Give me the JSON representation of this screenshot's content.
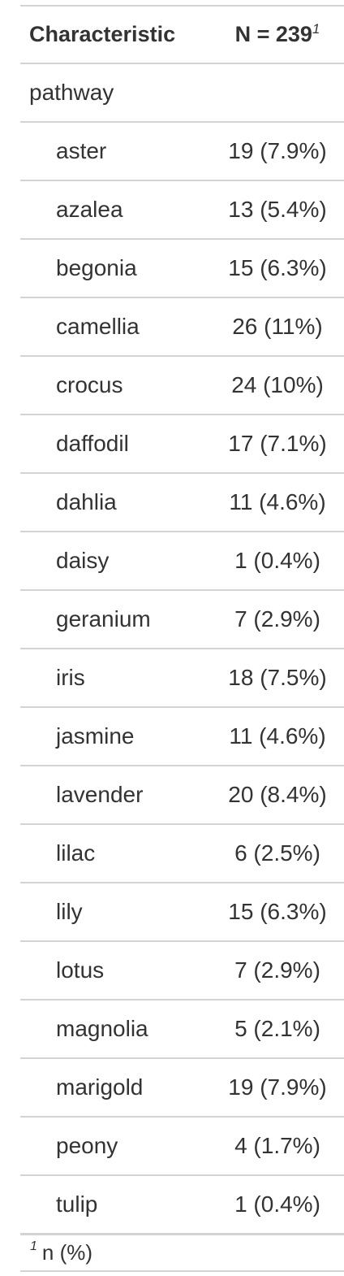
{
  "table": {
    "header": {
      "characteristic": "Characteristic",
      "n_label": "N = 239",
      "n_footnote_mark": "1"
    },
    "variable": "pathway",
    "rows": [
      {
        "label": "aster",
        "value": "19 (7.9%)"
      },
      {
        "label": "azalea",
        "value": "13 (5.4%)"
      },
      {
        "label": "begonia",
        "value": "15 (6.3%)"
      },
      {
        "label": "camellia",
        "value": "26 (11%)"
      },
      {
        "label": "crocus",
        "value": "24 (10%)"
      },
      {
        "label": "daffodil",
        "value": "17 (7.1%)"
      },
      {
        "label": "dahlia",
        "value": "11 (4.6%)"
      },
      {
        "label": "daisy",
        "value": "1 (0.4%)"
      },
      {
        "label": "geranium",
        "value": "7 (2.9%)"
      },
      {
        "label": "iris",
        "value": "18 (7.5%)"
      },
      {
        "label": "jasmine",
        "value": "11 (4.6%)"
      },
      {
        "label": "lavender",
        "value": "20 (8.4%)"
      },
      {
        "label": "lilac",
        "value": "6 (2.5%)"
      },
      {
        "label": "lily",
        "value": "15 (6.3%)"
      },
      {
        "label": "lotus",
        "value": "7 (2.9%)"
      },
      {
        "label": "magnolia",
        "value": "5 (2.1%)"
      },
      {
        "label": "marigold",
        "value": "19 (7.9%)"
      },
      {
        "label": "peony",
        "value": "4 (1.7%)"
      },
      {
        "label": "tulip",
        "value": "1 (0.4%)"
      }
    ],
    "footnote": {
      "mark": "1",
      "text": "n (%)"
    }
  }
}
